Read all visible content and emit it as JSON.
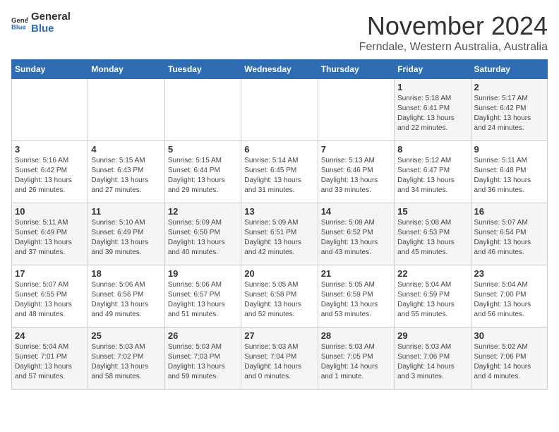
{
  "logo": {
    "general": "General",
    "blue": "Blue"
  },
  "title": "November 2024",
  "subtitle": "Ferndale, Western Australia, Australia",
  "headers": [
    "Sunday",
    "Monday",
    "Tuesday",
    "Wednesday",
    "Thursday",
    "Friday",
    "Saturday"
  ],
  "weeks": [
    [
      {
        "day": "",
        "info": ""
      },
      {
        "day": "",
        "info": ""
      },
      {
        "day": "",
        "info": ""
      },
      {
        "day": "",
        "info": ""
      },
      {
        "day": "",
        "info": ""
      },
      {
        "day": "1",
        "info": "Sunrise: 5:18 AM\nSunset: 6:41 PM\nDaylight: 13 hours\nand 22 minutes."
      },
      {
        "day": "2",
        "info": "Sunrise: 5:17 AM\nSunset: 6:42 PM\nDaylight: 13 hours\nand 24 minutes."
      }
    ],
    [
      {
        "day": "3",
        "info": "Sunrise: 5:16 AM\nSunset: 6:42 PM\nDaylight: 13 hours\nand 26 minutes."
      },
      {
        "day": "4",
        "info": "Sunrise: 5:15 AM\nSunset: 6:43 PM\nDaylight: 13 hours\nand 27 minutes."
      },
      {
        "day": "5",
        "info": "Sunrise: 5:15 AM\nSunset: 6:44 PM\nDaylight: 13 hours\nand 29 minutes."
      },
      {
        "day": "6",
        "info": "Sunrise: 5:14 AM\nSunset: 6:45 PM\nDaylight: 13 hours\nand 31 minutes."
      },
      {
        "day": "7",
        "info": "Sunrise: 5:13 AM\nSunset: 6:46 PM\nDaylight: 13 hours\nand 33 minutes."
      },
      {
        "day": "8",
        "info": "Sunrise: 5:12 AM\nSunset: 6:47 PM\nDaylight: 13 hours\nand 34 minutes."
      },
      {
        "day": "9",
        "info": "Sunrise: 5:11 AM\nSunset: 6:48 PM\nDaylight: 13 hours\nand 36 minutes."
      }
    ],
    [
      {
        "day": "10",
        "info": "Sunrise: 5:11 AM\nSunset: 6:49 PM\nDaylight: 13 hours\nand 37 minutes."
      },
      {
        "day": "11",
        "info": "Sunrise: 5:10 AM\nSunset: 6:49 PM\nDaylight: 13 hours\nand 39 minutes."
      },
      {
        "day": "12",
        "info": "Sunrise: 5:09 AM\nSunset: 6:50 PM\nDaylight: 13 hours\nand 40 minutes."
      },
      {
        "day": "13",
        "info": "Sunrise: 5:09 AM\nSunset: 6:51 PM\nDaylight: 13 hours\nand 42 minutes."
      },
      {
        "day": "14",
        "info": "Sunrise: 5:08 AM\nSunset: 6:52 PM\nDaylight: 13 hours\nand 43 minutes."
      },
      {
        "day": "15",
        "info": "Sunrise: 5:08 AM\nSunset: 6:53 PM\nDaylight: 13 hours\nand 45 minutes."
      },
      {
        "day": "16",
        "info": "Sunrise: 5:07 AM\nSunset: 6:54 PM\nDaylight: 13 hours\nand 46 minutes."
      }
    ],
    [
      {
        "day": "17",
        "info": "Sunrise: 5:07 AM\nSunset: 6:55 PM\nDaylight: 13 hours\nand 48 minutes."
      },
      {
        "day": "18",
        "info": "Sunrise: 5:06 AM\nSunset: 6:56 PM\nDaylight: 13 hours\nand 49 minutes."
      },
      {
        "day": "19",
        "info": "Sunrise: 5:06 AM\nSunset: 6:57 PM\nDaylight: 13 hours\nand 51 minutes."
      },
      {
        "day": "20",
        "info": "Sunrise: 5:05 AM\nSunset: 6:58 PM\nDaylight: 13 hours\nand 52 minutes."
      },
      {
        "day": "21",
        "info": "Sunrise: 5:05 AM\nSunset: 6:59 PM\nDaylight: 13 hours\nand 53 minutes."
      },
      {
        "day": "22",
        "info": "Sunrise: 5:04 AM\nSunset: 6:59 PM\nDaylight: 13 hours\nand 55 minutes."
      },
      {
        "day": "23",
        "info": "Sunrise: 5:04 AM\nSunset: 7:00 PM\nDaylight: 13 hours\nand 56 minutes."
      }
    ],
    [
      {
        "day": "24",
        "info": "Sunrise: 5:04 AM\nSunset: 7:01 PM\nDaylight: 13 hours\nand 57 minutes."
      },
      {
        "day": "25",
        "info": "Sunrise: 5:03 AM\nSunset: 7:02 PM\nDaylight: 13 hours\nand 58 minutes."
      },
      {
        "day": "26",
        "info": "Sunrise: 5:03 AM\nSunset: 7:03 PM\nDaylight: 13 hours\nand 59 minutes."
      },
      {
        "day": "27",
        "info": "Sunrise: 5:03 AM\nSunset: 7:04 PM\nDaylight: 14 hours\nand 0 minutes."
      },
      {
        "day": "28",
        "info": "Sunrise: 5:03 AM\nSunset: 7:05 PM\nDaylight: 14 hours\nand 1 minute."
      },
      {
        "day": "29",
        "info": "Sunrise: 5:03 AM\nSunset: 7:06 PM\nDaylight: 14 hours\nand 3 minutes."
      },
      {
        "day": "30",
        "info": "Sunrise: 5:02 AM\nSunset: 7:06 PM\nDaylight: 14 hours\nand 4 minutes."
      }
    ]
  ]
}
